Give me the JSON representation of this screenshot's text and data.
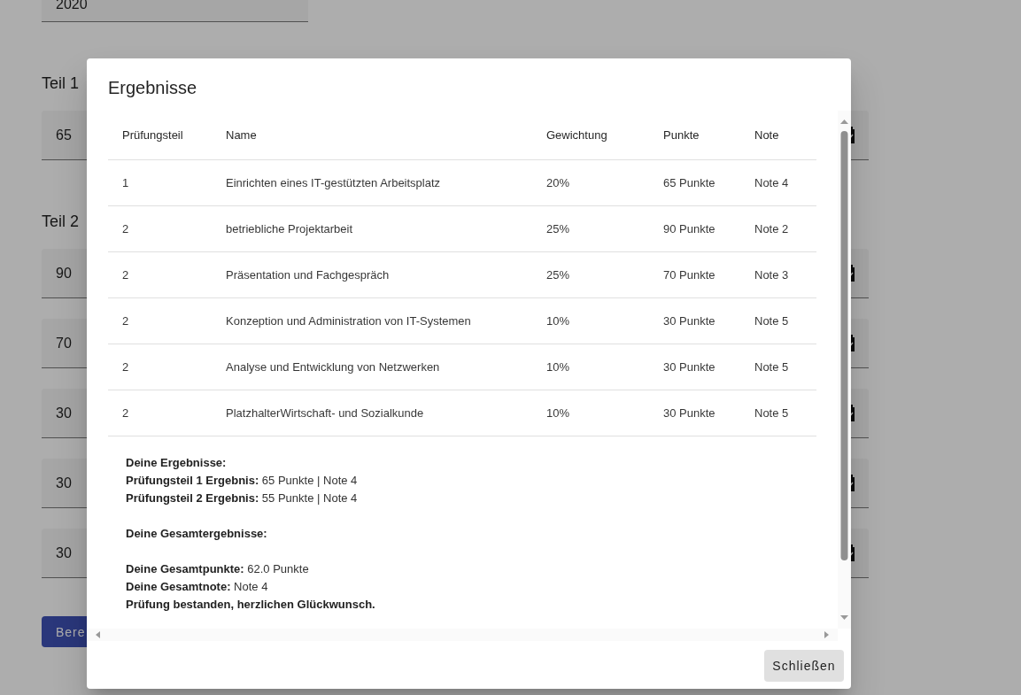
{
  "page": {
    "year_select": {
      "value": "2020"
    },
    "sections": [
      {
        "title": "Teil 1",
        "fields": [
          {
            "value": "65"
          }
        ]
      },
      {
        "title": "Teil 2",
        "fields": [
          {
            "value": "90"
          },
          {
            "value": "70"
          },
          {
            "value": "30"
          },
          {
            "value": "30"
          },
          {
            "value": "30"
          }
        ]
      }
    ],
    "button": "Bere"
  },
  "dialog": {
    "title": "Ergebnisse",
    "table": {
      "columns": [
        "Prüfungsteil",
        "Name",
        "Gewichtung",
        "Punkte",
        "Note"
      ],
      "rows": [
        [
          "1",
          "Einrichten eines IT-gestützten Arbeitsplatz",
          "20%",
          "65 Punkte",
          "Note 4"
        ],
        [
          "2",
          "betriebliche Projektarbeit",
          "25%",
          "90 Punkte",
          "Note 2"
        ],
        [
          "2",
          "Präsentation und Fachgespräch",
          "25%",
          "70 Punkte",
          "Note 3"
        ],
        [
          "2",
          "Konzeption und Administration von IT-Systemen",
          "10%",
          "30 Punkte",
          "Note 5"
        ],
        [
          "2",
          "Analyse und Entwicklung von Netzwerken",
          "10%",
          "30 Punkte",
          "Note 5"
        ],
        [
          "2",
          "PlatzhalterWirtschaft- und Sozialkunde",
          "10%",
          "30 Punkte",
          "Note 5"
        ]
      ]
    },
    "summary": [
      [
        {
          "kind": "heading",
          "text": "Deine Ergebnisse:"
        },
        {
          "kind": "line",
          "text": "**Prüfungsteil 1 Ergebnis:** 65 Punkte | Note 4"
        },
        {
          "kind": "line",
          "text": "**Prüfungsteil 2 Ergebnis:** 55 Punkte | Note 4"
        }
      ],
      [
        {
          "kind": "heading",
          "text": "Deine Gesamtergebnisse:"
        }
      ],
      [
        {
          "kind": "line",
          "text": "**Deine Gesamtpunkte:** 62.0 Punkte"
        },
        {
          "kind": "line",
          "text": "**Deine Gesamtnote:** Note 4"
        },
        {
          "kind": "heading",
          "text": "Prüfung bestanden, herzlichen Glückwunsch."
        }
      ]
    ],
    "close_button": "Schließen"
  }
}
